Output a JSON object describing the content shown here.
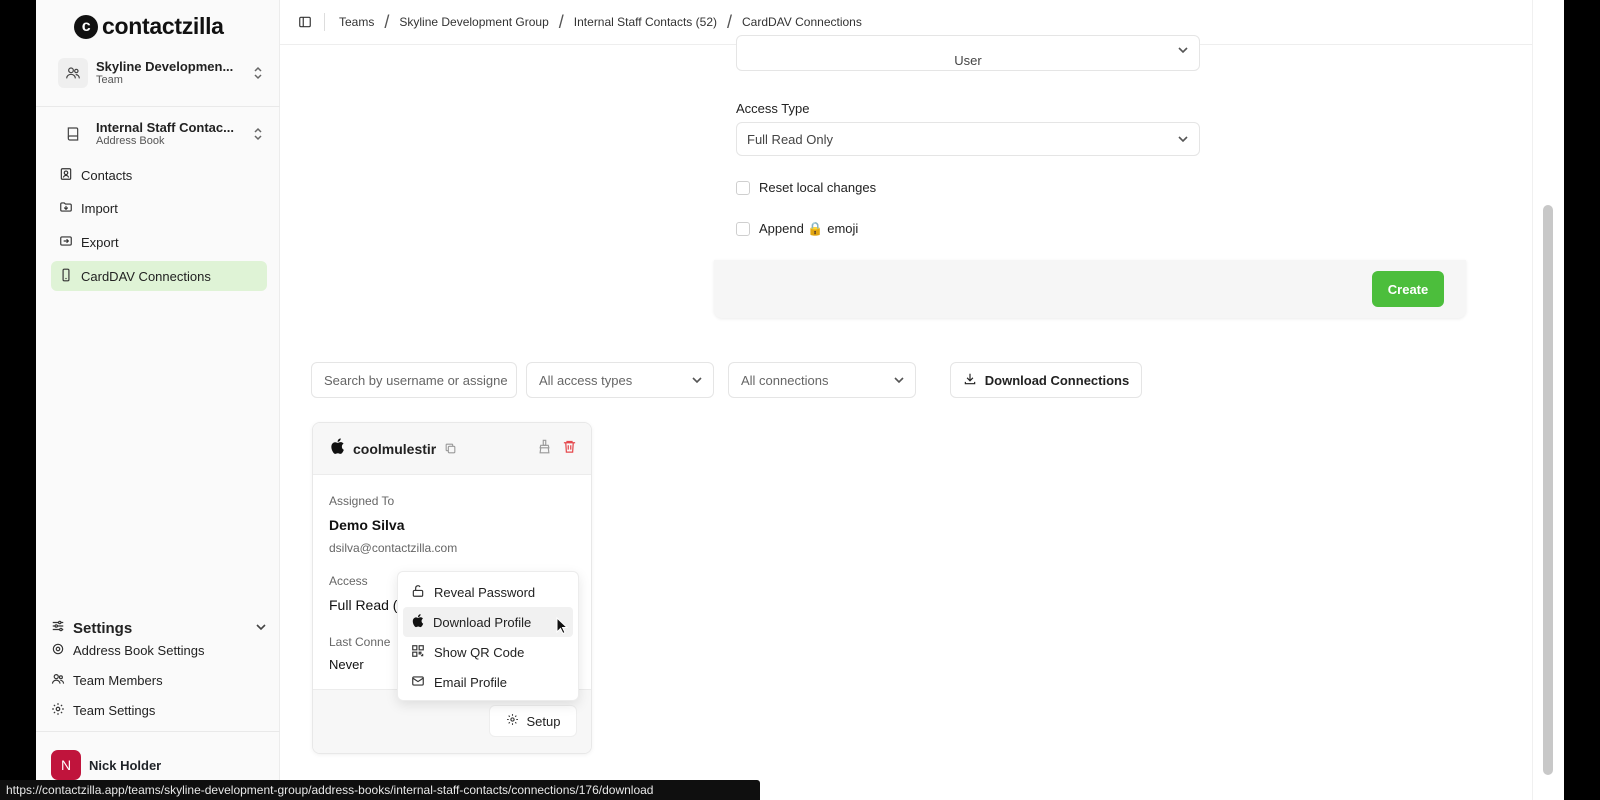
{
  "brand": {
    "name": "contactzilla"
  },
  "switchers": {
    "team": {
      "title": "Skyline Developmen...",
      "subtitle": "Team"
    },
    "address_book": {
      "title": "Internal Staff Contac...",
      "subtitle": "Address Book"
    }
  },
  "nav": {
    "items": [
      {
        "label": "Contacts",
        "icon": "contact-card-icon"
      },
      {
        "label": "Import",
        "icon": "import-icon"
      },
      {
        "label": "Export",
        "icon": "export-icon"
      },
      {
        "label": "CardDAV Connections",
        "icon": "device-icon",
        "active": true
      }
    ]
  },
  "settings": {
    "heading": "Settings",
    "items": [
      {
        "label": "Address Book Settings"
      },
      {
        "label": "Team Members"
      },
      {
        "label": "Team Settings"
      }
    ]
  },
  "user": {
    "initial": "N",
    "name": "Nick Holder"
  },
  "breadcrumb": {
    "items": [
      "Teams",
      "Skyline Development Group",
      "Internal Staff Contacts (52)",
      "CardDAV Connections"
    ],
    "separator": "/"
  },
  "form": {
    "assignee_select_value": "User",
    "access_type_label": "Access Type",
    "access_type_value": "Full Read Only",
    "reset_label": "Reset local changes",
    "append_label": "Append 🔒 emoji",
    "create_label": "Create"
  },
  "filters": {
    "search_placeholder": "Search by username or assigne",
    "access_types": "All access types",
    "connections": "All connections",
    "download_label": "Download Connections"
  },
  "card": {
    "username": "coolmulestir",
    "assigned_to_label": "Assigned To",
    "assignee_name": "Demo Silva",
    "assignee_email": "dsilva@contactzilla.com",
    "access_label": "Access",
    "access_value": "Full Read (",
    "last_connected_label": "Last Conne",
    "last_connected_value": "Never",
    "setup_label": "Setup"
  },
  "menu": {
    "items": [
      {
        "label": "Reveal Password",
        "icon": "unlock-icon"
      },
      {
        "label": "Download Profile",
        "icon": "apple-icon",
        "hover": true
      },
      {
        "label": "Show QR Code",
        "icon": "qr-code-icon"
      },
      {
        "label": "Email Profile",
        "icon": "mail-icon"
      }
    ]
  },
  "status_url": "https://contactzilla.app/teams/skyline-development-group/address-books/internal-staff-contacts/connections/176/download",
  "colors": {
    "accent": "#4cbe3c",
    "active_nav_bg": "#dff3d6",
    "delete": "#e5484d"
  }
}
